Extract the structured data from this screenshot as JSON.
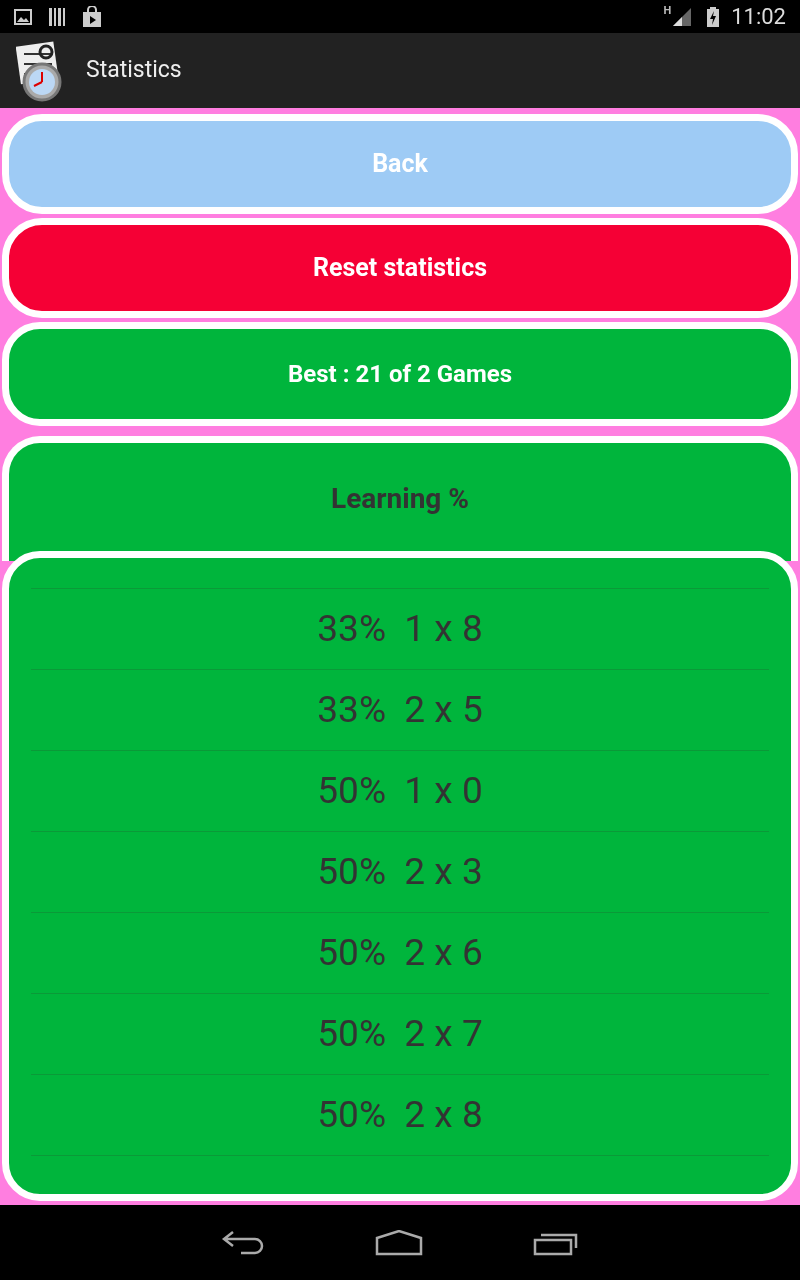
{
  "status_bar": {
    "network": "H",
    "time": "11:02"
  },
  "app_bar": {
    "title": "Statistics"
  },
  "buttons": [
    {
      "label": "Back",
      "color": "#9ecbf5"
    },
    {
      "label": "Reset statistics",
      "color": "#f50035"
    }
  ],
  "best": "Best : 21 of 2 Games",
  "learning": {
    "title": "Learning %",
    "rows": [
      "33%  1 x 8",
      "33%  2 x 5",
      "50%  1 x 0",
      "50%  2 x 3",
      "50%  2 x 6",
      "50%  2 x 7",
      "50%  2 x 8"
    ]
  }
}
